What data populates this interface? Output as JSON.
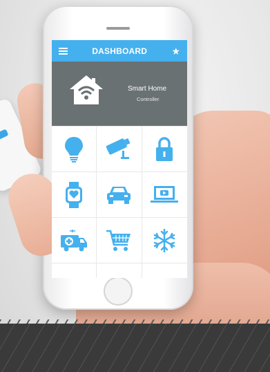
{
  "app": {
    "title": "DASHBOARD",
    "hero": {
      "line1": "Smart Home",
      "line2": "Controller"
    }
  },
  "icons": [
    "lightbulb-icon",
    "security-camera-icon",
    "padlock-icon",
    "smartwatch-heart-icon",
    "car-icon",
    "laptop-play-icon",
    "ambulance-icon",
    "shopping-cart-icon",
    "snowflake-icon"
  ],
  "colors": {
    "accent": "#45b0ee",
    "hero_bg": "#6a7173",
    "icon_color": "#45b0ee"
  }
}
